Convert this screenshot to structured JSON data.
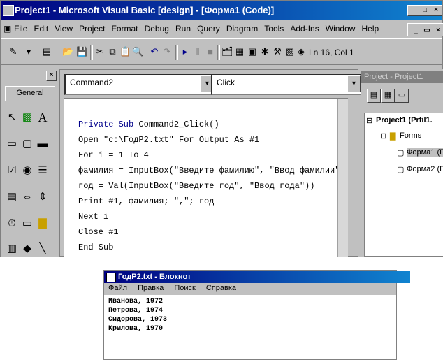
{
  "vb": {
    "title": "Project1 - Microsoft Visual Basic [design] - [Форма1 (Code)]",
    "menu": [
      "File",
      "Edit",
      "View",
      "Project",
      "Format",
      "Debug",
      "Run",
      "Query",
      "Diagram",
      "Tools",
      "Add-Ins",
      "Window",
      "Help"
    ],
    "cursor_position": "Ln 16, Col 1",
    "toolbox": {
      "tab_label": "General"
    },
    "object_combo": "Command2",
    "procedure_combo": "Click",
    "code_lines": [
      "Private Sub Command2_Click()",
      "Open \"c:\\ГодP2.txt\" For Output As #1",
      "For i = 1 To 4",
      "фамилия = InputBox(\"Введите фамилию\", \"Ввод фамилии\")",
      "год = Val(InputBox(\"Введите год\", \"Ввод года\"))",
      "Print #1, фамилия; \",\"; год",
      "Next i",
      "Close #1",
      "End Sub"
    ],
    "project_explorer": {
      "title": "Project - Project1",
      "root": "Project1 (Prfil1.",
      "folder": "Forms",
      "forms": [
        "Форма1 (Г",
        "Форма2 (Г"
      ]
    }
  },
  "notepad": {
    "title": "ГодР2.txt - Блокнот",
    "menu": [
      "Файл",
      "Правка",
      "Поиск",
      "Справка"
    ],
    "lines": [
      "Иванова, 1972",
      "Петрова, 1974",
      "Сидорова, 1973",
      "Крылова, 1970"
    ]
  }
}
